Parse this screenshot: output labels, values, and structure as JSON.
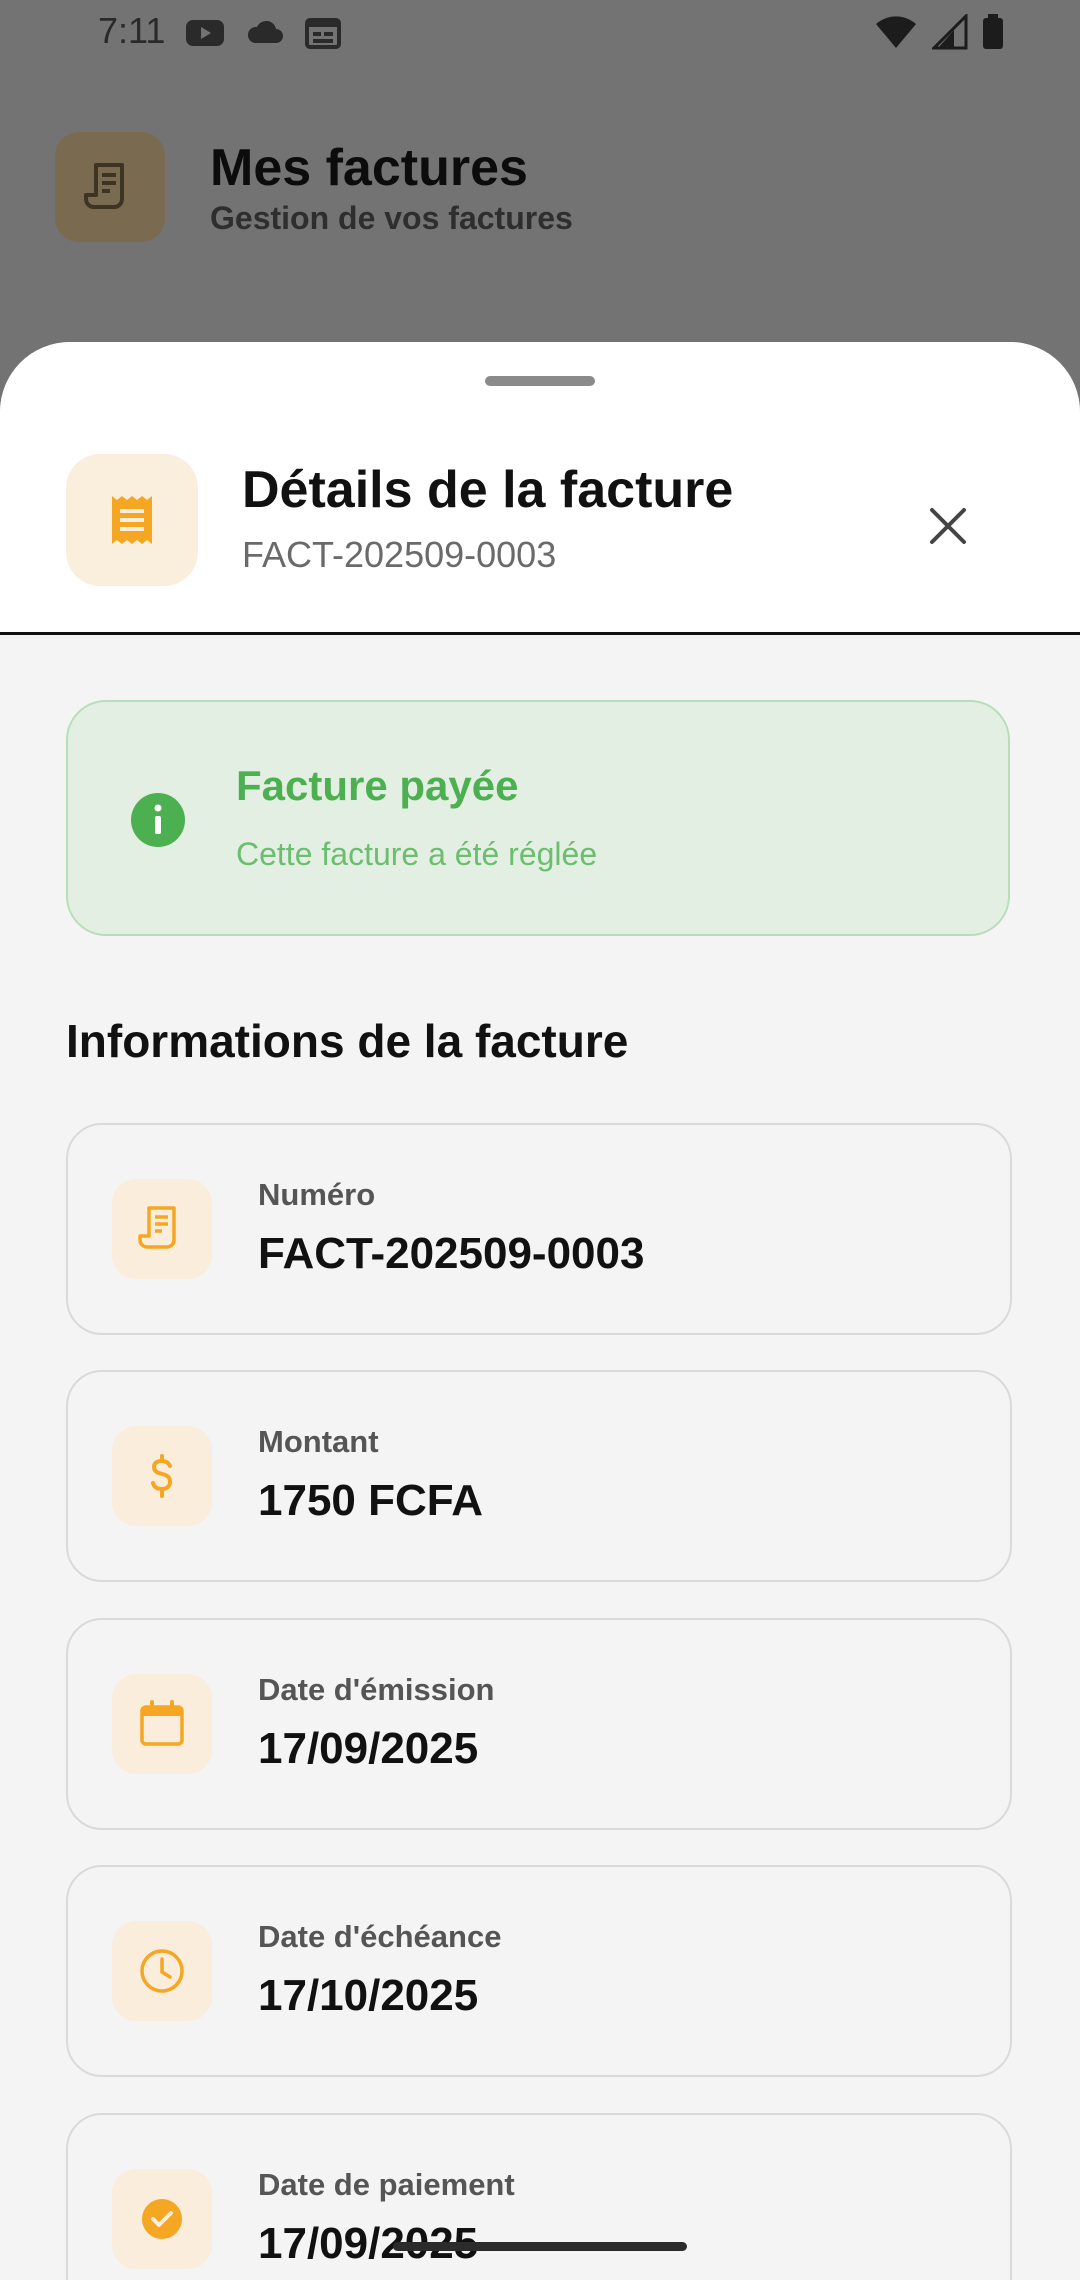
{
  "status_bar": {
    "time": "7:11"
  },
  "background_app": {
    "title": "Mes factures",
    "subtitle": "Gestion de vos factures"
  },
  "sheet": {
    "title": "Détails de la facture",
    "subtitle": "FACT-202509-0003"
  },
  "status_banner": {
    "title": "Facture payée",
    "description": "Cette facture a été réglée"
  },
  "section": {
    "title": "Informations de la facture"
  },
  "info_items": [
    {
      "label": "Numéro",
      "value": "FACT-202509-0003",
      "icon": "receipt-icon"
    },
    {
      "label": "Montant",
      "value": "1750 FCFA",
      "icon": "dollar-icon"
    },
    {
      "label": "Date d'émission",
      "value": "17/09/2025",
      "icon": "calendar-icon"
    },
    {
      "label": "Date d'échéance",
      "value": "17/10/2025",
      "icon": "clock-icon"
    },
    {
      "label": "Date de paiement",
      "value": "17/09/2025",
      "icon": "check-circle-icon"
    }
  ],
  "colors": {
    "accent": "#F5A623",
    "success": "#4CAF50",
    "success_bg": "#E3EFE3",
    "icon_bg": "#FAEDDC"
  }
}
